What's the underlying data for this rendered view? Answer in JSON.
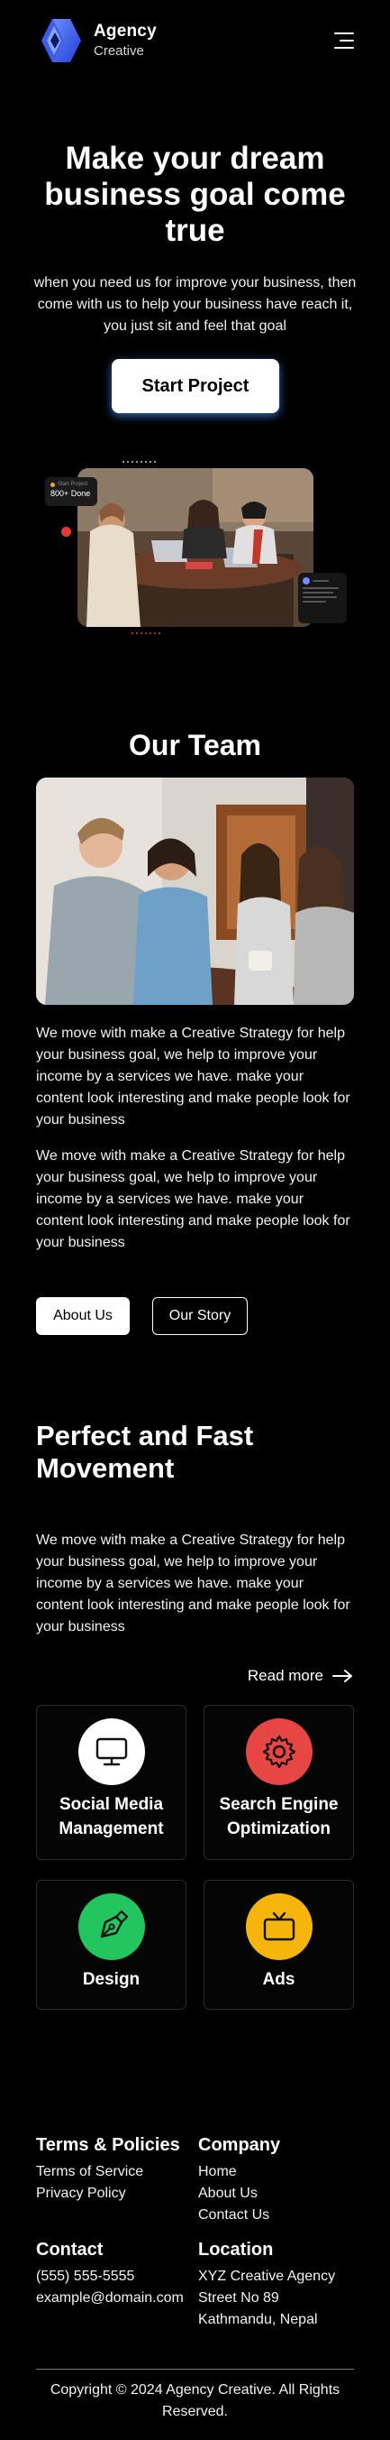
{
  "header": {
    "brand_name": "Agency",
    "brand_sub": "Creative"
  },
  "hero": {
    "title": "Make your dream business goal come true",
    "text": "when you need us for improve your business, then come with us to help your business have reach it, you just sit and feel that goal",
    "cta_label": "Start Project",
    "badge_small": "Start Project",
    "badge_value": "800+ Done"
  },
  "team": {
    "title": "Our Team",
    "paragraph_1": "We move with make a Creative Strategy for help your business goal, we help to improve your income by a services we have. make your content look interesting and make people look for your business",
    "paragraph_2": "We move with make a Creative Strategy for help your business goal, we help to improve your income by a services we have. make your content look interesting and make people look for your business",
    "about_label": "About Us",
    "story_label": "Our Story"
  },
  "movement": {
    "title": "Perfect and Fast Movement",
    "paragraph": "We move with make a Creative Strategy for help your business goal, we help to improve your income by a services we have. make your content look interesting and make people look for your business",
    "read_more": "Read more",
    "services": [
      {
        "label": "Social Media Management",
        "icon": "monitor-icon",
        "color": "#ffffff"
      },
      {
        "label": "Search Engine Optimization",
        "icon": "gear-icon",
        "color": "#e84545"
      },
      {
        "label": "Design",
        "icon": "pen-tool-icon",
        "color": "#22c55e"
      },
      {
        "label": "Ads",
        "icon": "tv-icon",
        "color": "#f5b50a"
      }
    ]
  },
  "footer": {
    "terms_title": "Terms & Policies",
    "terms_links": [
      "Terms of Service",
      "Privacy Policy"
    ],
    "company_title": "Company",
    "company_links": [
      "Home",
      "About Us",
      "Contact Us"
    ],
    "contact_title": "Contact",
    "phone": "(555) 555-5555",
    "email": "example@domain.com",
    "location_title": "Location",
    "location_lines": [
      "XYZ Creative Agency",
      "Street No 89",
      "Kathmandu, Nepal"
    ],
    "copyright": "Copyright © 2024 Agency Creative. All Rights Reserved."
  },
  "colors": {
    "background": "#000000",
    "cta_glow": "#468cff",
    "seo_red": "#e84545",
    "design_green": "#22c55e",
    "ads_yellow": "#f5b50a"
  }
}
